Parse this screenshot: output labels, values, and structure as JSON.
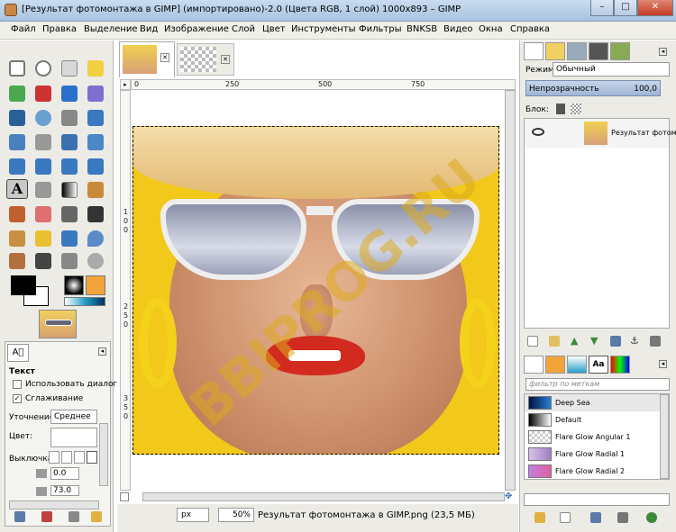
{
  "window": {
    "title": "[Результат фотомонтажа в GIMP] (импортировано)-2.0 (Цвета RGB, 1 слой) 1000x893 – GIMP",
    "min": "–",
    "max": "□",
    "close": "✕"
  },
  "menu": [
    "Файл",
    "Правка",
    "Выделение",
    "Вид",
    "Изображение",
    "Слой",
    "Цвет",
    "Инструменты",
    "Фильтры",
    "BNKSB",
    "Видео",
    "Окна",
    "Справка"
  ],
  "rulers": {
    "top": [
      "0",
      "250",
      "500",
      "750"
    ],
    "left": [
      "1",
      "0",
      "0",
      "2",
      "5",
      "0",
      "3",
      "5",
      "0"
    ]
  },
  "status": {
    "unit": "px",
    "zoom": "50%",
    "info": "Результат фотомонтажа в GIMP.png (23,5 МБ)"
  },
  "tool_options": {
    "title": "Текст",
    "use_dialog": "Использовать диалог",
    "antialias": "Сглаживание",
    "hinting_label": "Уточнение:",
    "hinting_value": "Среднее",
    "color_label": "Цвет:",
    "justify_label": "Выключка:",
    "indent_value": "0.0",
    "spacing_value": "73.0"
  },
  "layers": {
    "mode_label": "Режим:",
    "mode_value": "Обычный",
    "opacity_label": "Непрозрачность",
    "opacity_value": "100,0",
    "lock_label": "Блок:",
    "layer_name": "Результат фотом"
  },
  "gradients": {
    "filter_placeholder": "фильтр по меткам",
    "items": [
      "Deep Sea",
      "Default",
      "Flare Glow Angular 1",
      "Flare Glow Radial 1",
      "Flare Glow Radial 2"
    ]
  },
  "watermark": "BBIPROG.RU",
  "colors": {
    "accent": "#3a6ea5",
    "yellow": "#f2c81a",
    "lip": "#d32a20"
  }
}
